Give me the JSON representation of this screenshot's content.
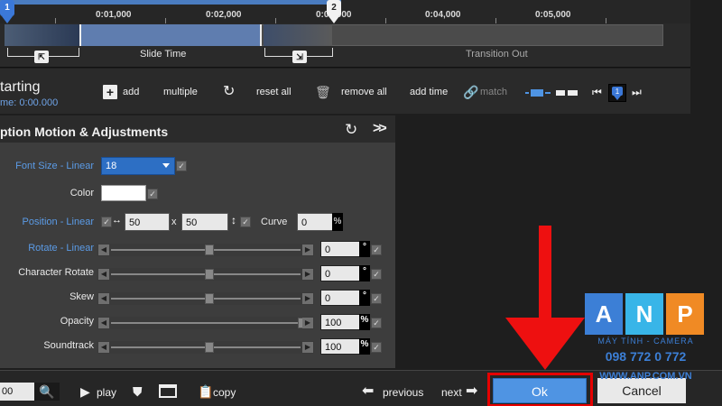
{
  "timeline": {
    "ticks": [
      "0:01,000",
      "0:02,000",
      "0:03,000",
      "0:04,000",
      "0:05,000"
    ],
    "markers": [
      "1",
      "2"
    ],
    "segments": {
      "slide_time": "Slide Time",
      "transition_out": "Transition Out"
    }
  },
  "toolbar": {
    "title": "tarting",
    "time": "me: 0:00.000",
    "add": "add",
    "multiple": "multiple",
    "reset_all": "reset all",
    "remove_all": "remove all",
    "add_time": "add time",
    "match": "match",
    "keyframe_marker": "1"
  },
  "panel": {
    "title": "ption Motion & Adjustments",
    "rows": {
      "font_size": {
        "label": "Font Size - Linear",
        "value": "18"
      },
      "color": {
        "label": "Color",
        "value": "#ffffff"
      },
      "position": {
        "label": "Position - Linear",
        "x": "50",
        "x_sep": "x",
        "y": "50",
        "curve_label": "Curve",
        "curve": "0",
        "curve_unit": "%"
      },
      "rotate": {
        "label": "Rotate - Linear",
        "value": "0",
        "unit": "°",
        "slider_level": 0.5
      },
      "character_rotate": {
        "label": "Character Rotate",
        "value": "0",
        "unit": "°",
        "slider_level": 0.5
      },
      "skew": {
        "label": "Skew",
        "value": "0",
        "unit": "°",
        "slider_level": 0.5
      },
      "opacity": {
        "label": "Opacity",
        "value": "100",
        "unit": "%",
        "slider_level": 1.0
      },
      "soundtrack": {
        "label": "Soundtrack",
        "value": "100",
        "unit": "%",
        "slider_level": 0.5
      }
    }
  },
  "bottom": {
    "zoom_value": "00",
    "play": "play",
    "copy": "copy",
    "previous": "previous",
    "next": "next",
    "ok": "Ok",
    "cancel": "Cancel"
  },
  "watermark": {
    "letters": [
      "A",
      "N",
      "P"
    ],
    "tagline": "MÁY TÍNH - CAMERA",
    "phone": "098 772 0 772",
    "website": "WWW.ANP.COM.VN"
  },
  "colors": {
    "accent": "#4f94e3",
    "highlight": "#e60000",
    "label_blue": "#5b9be6"
  }
}
